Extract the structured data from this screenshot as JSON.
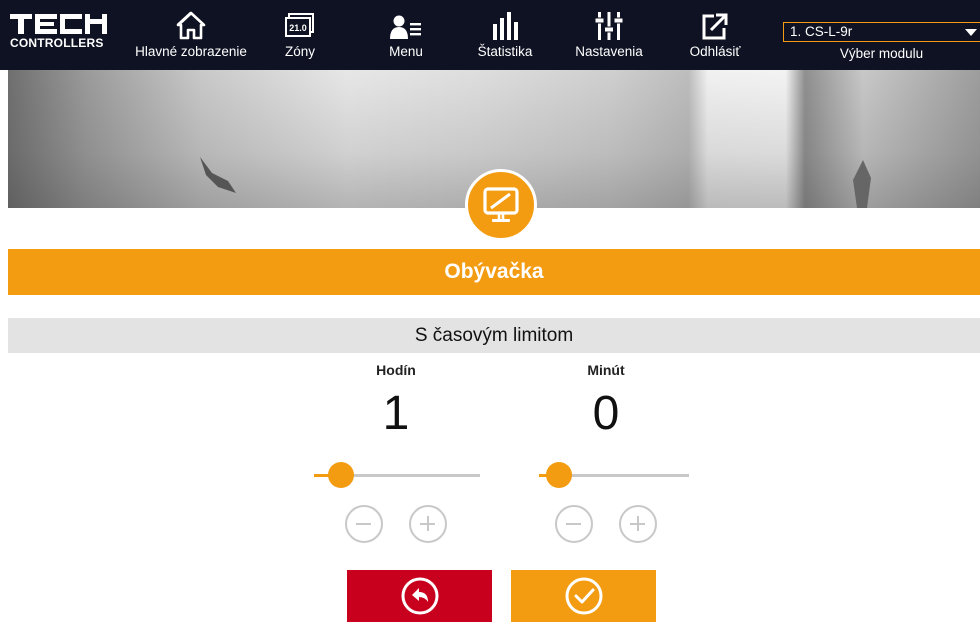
{
  "nav": {
    "logo_text": "CONTROLLERS",
    "items": [
      {
        "label": "Hlavné zobrazenie",
        "icon": "home-icon"
      },
      {
        "label": "Zóny",
        "icon": "zones-icon",
        "badge": "21.0"
      },
      {
        "label": "Menu",
        "icon": "user-menu-icon"
      },
      {
        "label": "Štatistika",
        "icon": "statistics-icon"
      },
      {
        "label": "Nastavenia",
        "icon": "settings-sliders-icon"
      },
      {
        "label": "Odhlásiť",
        "icon": "logout-icon"
      }
    ],
    "module_select_value": "1. CS-L-9r",
    "module_label": "Výber modulu"
  },
  "zone": {
    "icon": "monitor-icon",
    "name": "Obývačka"
  },
  "mode": {
    "title": "S časovým limitom"
  },
  "time_limit": {
    "hours_label": "Hodín",
    "hours_value": "1",
    "minutes_label": "Minút",
    "minutes_value": "0",
    "hours_slider_fraction": 0.05,
    "minutes_slider_fraction": 0.0
  },
  "actions": {
    "back_icon": "back-arrow-icon",
    "confirm_icon": "checkmark-icon"
  },
  "colors": {
    "accent": "#f39c12",
    "topbar": "#0f1222",
    "back_button": "#c8001d"
  }
}
